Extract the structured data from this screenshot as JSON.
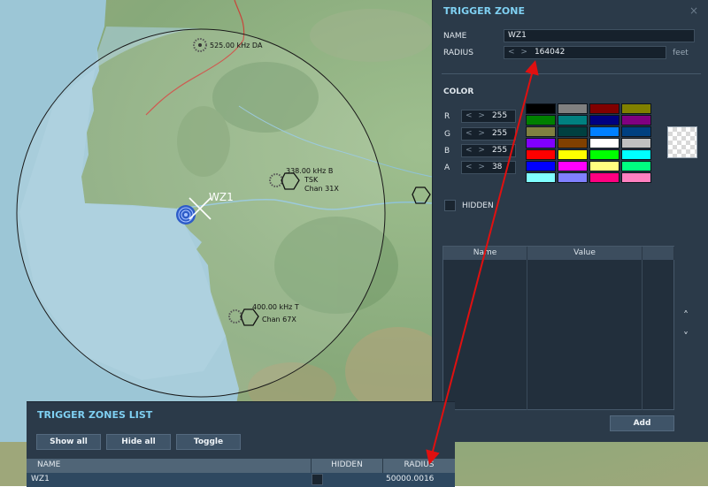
{
  "map": {
    "zone_label": "WZ1",
    "nav_labels": [
      "525.00 kHz DA",
      "338.00 kHz B",
      "TSK",
      "Chan 31X",
      "400.00 kHz T",
      "Chan 67X"
    ]
  },
  "trigger_zone": {
    "title": "TRIGGER ZONE",
    "close": "×",
    "name_label": "NAME",
    "name_value": "WZ1",
    "radius_label": "RADIUS",
    "radius_value": "164042",
    "radius_unit": "feet",
    "spinner_arrows": "< >",
    "color_label": "COLOR",
    "channels": [
      {
        "label": "R",
        "value": "255"
      },
      {
        "label": "G",
        "value": "255"
      },
      {
        "label": "B",
        "value": "255"
      },
      {
        "label": "A",
        "value": "38"
      }
    ],
    "palette": [
      "#000000",
      "#808080",
      "#800000",
      "#808000",
      "#008000",
      "#008080",
      "#000080",
      "#800080",
      "#808040",
      "#004040",
      "#0080ff",
      "#004080",
      "#8000ff",
      "#804000",
      "#ffffff",
      "#c0c0c0",
      "#ff0000",
      "#ffff00",
      "#00ff00",
      "#00ffff",
      "#0000ff",
      "#ff00ff",
      "#ffff80",
      "#00ff80",
      "#80ffff",
      "#8080ff",
      "#ff0080",
      "#ff80c0"
    ],
    "hidden_label": "HIDDEN",
    "table_headers": [
      "Name",
      "Value"
    ],
    "chevron_up": "˄",
    "chevron_down": "˅",
    "add_label": "Add"
  },
  "zones_list": {
    "title": "TRIGGER ZONES LIST",
    "buttons": [
      "Show all",
      "Hide all",
      "Toggle"
    ],
    "headers": [
      "NAME",
      "HIDDEN",
      "RADIUS"
    ],
    "rows": [
      {
        "name": "WZ1",
        "radius": "50000.0016"
      }
    ]
  },
  "colors": {
    "accent": "#7fd0f2",
    "panel_bg": "#2b3a49",
    "annotation_red": "#e01010",
    "zone_circle": "#1a1a1a"
  }
}
